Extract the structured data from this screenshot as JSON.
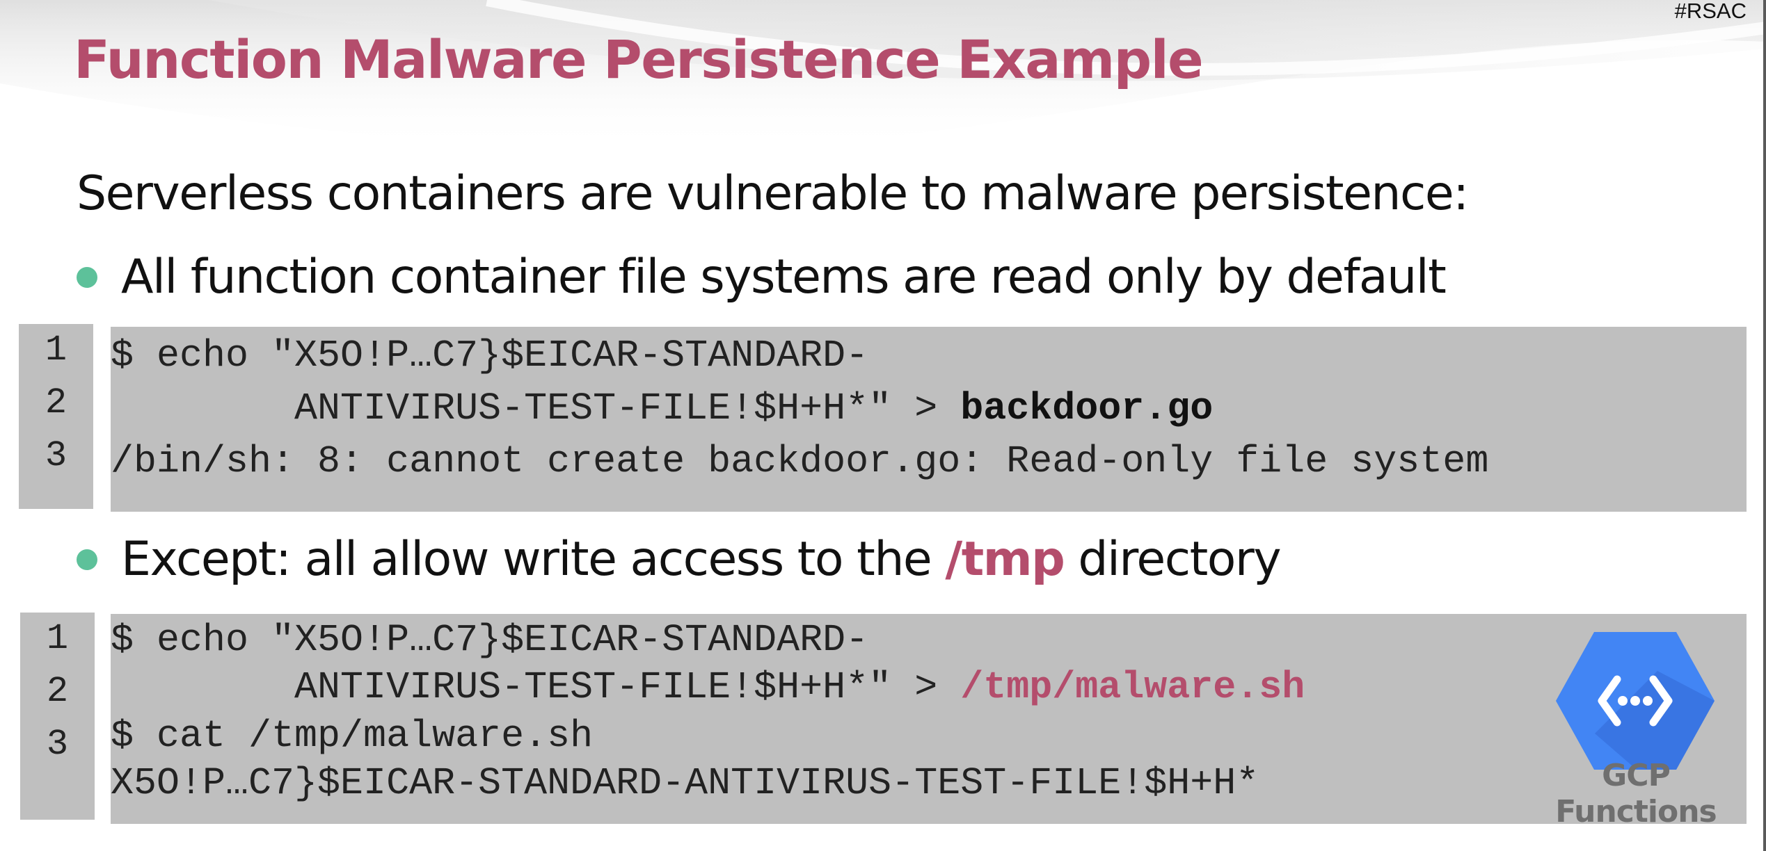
{
  "slide": {
    "hashtag": "#RSAC",
    "title": "Function Malware Persistence Example",
    "intro": "Serverless containers are vulnerable to malware persistence:",
    "bullet1": {
      "text": "All function container file systems are read only by default"
    },
    "code_block_1": {
      "line_numbers": [
        "1",
        "2",
        "3"
      ],
      "line1": "$ echo \"X5O!P…C7}$EICAR-STANDARD-",
      "line2_prefix": "        ANTIVIRUS-TEST-FILE!$H+H*\" > ",
      "line2_target": "backdoor.go",
      "line3": "/bin/sh: 8: cannot create backdoor.go: Read-only file system"
    },
    "bullet2": {
      "text_before": "Except: all allow write access to the ",
      "highlight": "/tmp",
      "text_after": " directory"
    },
    "code_block_2": {
      "line_numbers": [
        "1",
        "2",
        "3"
      ],
      "line1": "$ echo \"X5O!P…C7}$EICAR-STANDARD-",
      "line2_prefix": "        ANTIVIRUS-TEST-FILE!$H+H*\" > ",
      "line2_target": "/tmp/malware.sh",
      "line3": "$ cat /tmp/malware.sh",
      "line4": "X5O!P…C7}$EICAR-STANDARD-ANTIVIRUS-TEST-FILE!$H+H*"
    },
    "gcp_logo": {
      "icon": "gcp-functions-icon",
      "label_line1": "GCP",
      "label_line2": "Functions"
    },
    "colors": {
      "accent": "#b44d6c",
      "bullet": "#5dc19a",
      "code_background": "#bfbfbf",
      "gcp_blue": "#4285f4"
    }
  }
}
